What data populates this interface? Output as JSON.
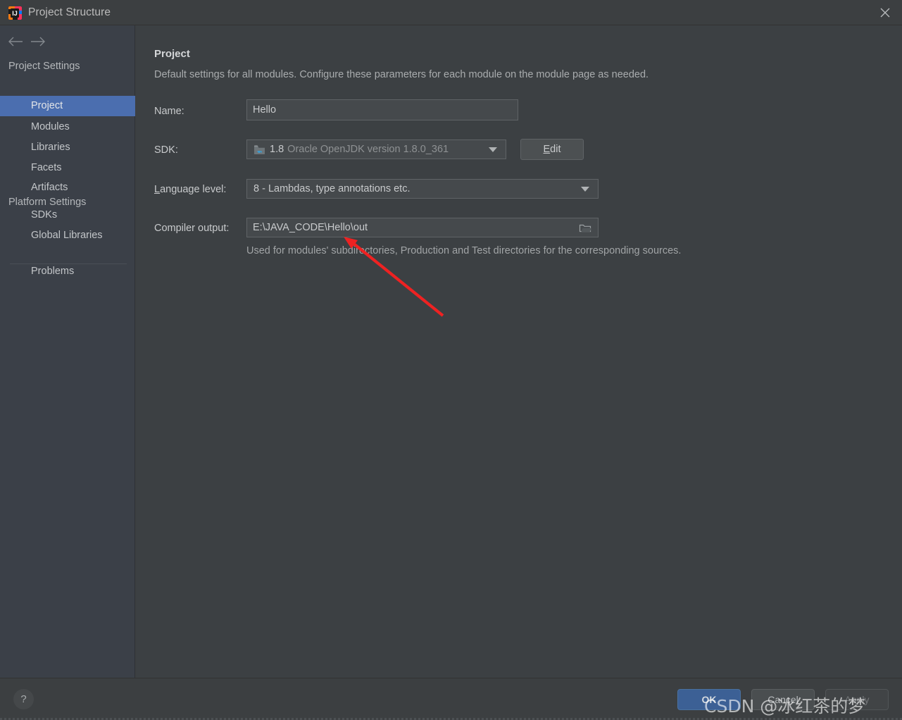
{
  "window": {
    "title": "Project Structure",
    "app_icon": "intellij-idea-icon",
    "close_icon": "close-icon"
  },
  "nav": {
    "back_icon": "arrow-left-icon",
    "forward_icon": "arrow-right-icon"
  },
  "sidebar": {
    "groups": [
      {
        "label": "Project Settings"
      },
      {
        "label": "Platform Settings"
      }
    ],
    "items": [
      {
        "label": "Project",
        "selected": true
      },
      {
        "label": "Modules",
        "selected": false
      },
      {
        "label": "Libraries",
        "selected": false
      },
      {
        "label": "Facets",
        "selected": false
      },
      {
        "label": "Artifacts",
        "selected": false
      },
      {
        "label": "SDKs",
        "selected": false
      },
      {
        "label": "Global Libraries",
        "selected": false
      },
      {
        "label": "Problems",
        "selected": false
      }
    ]
  },
  "main": {
    "title": "Project",
    "description": "Default settings for all modules. Configure these parameters for each module on the module page as needed.",
    "name_field": {
      "label": "Name:",
      "value": "Hello",
      "placeholder": ""
    },
    "sdk_field": {
      "label": "SDK:",
      "icon": "jdk-folder-icon",
      "version": "1.8",
      "description": "Oracle OpenJDK version 1.8.0_361",
      "dropdown_icon": "chevron-down-icon",
      "edit_button": {
        "mnemonic": "E",
        "rest": "dit"
      }
    },
    "language_level_field": {
      "label_mnemonic": "L",
      "label_rest": "anguage level:",
      "value": "8 - Lambdas, type annotations etc.",
      "dropdown_icon": "chevron-down-icon"
    },
    "compiler_output_field": {
      "label": "Compiler output:",
      "value": "E:\\JAVA_CODE\\Hello\\out",
      "placeholder": "",
      "browse_icon": "folder-icon",
      "hint": "Used for modules' subdirectories, Production and Test directories for the corresponding sources."
    }
  },
  "footer": {
    "help_icon": "question-mark-icon",
    "ok_label": "OK",
    "cancel_label": "Cancel",
    "apply_label": "Apply"
  },
  "annotations": {
    "arrow_color": "#ee2222",
    "watermark": "CSDN @冰红茶的梦"
  },
  "colors": {
    "window_bg": "#3c3f41",
    "sidebar_bg": "#3b4048",
    "content_bg": "#3c4043",
    "selection_blue": "#4b6eaf",
    "ok_button_blue": "#3c6095",
    "field_bg": "#45494c",
    "text_primary": "#c8cacc",
    "text_muted": "#8e9193"
  }
}
